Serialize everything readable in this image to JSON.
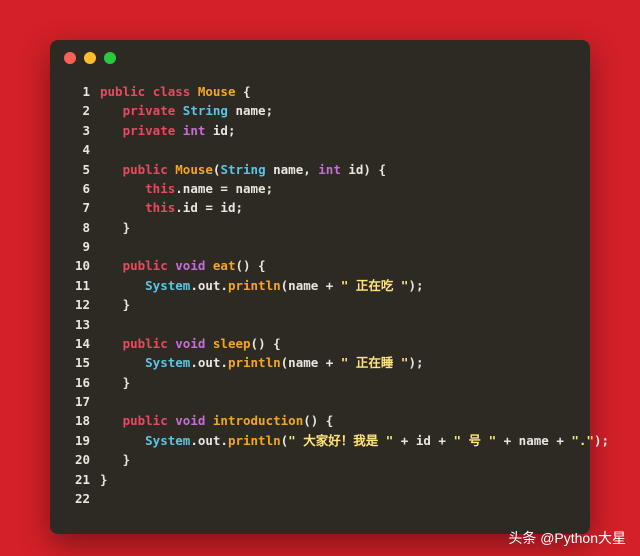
{
  "footer": "头条 @Python大星",
  "code": {
    "lines": [
      {
        "n": 1,
        "tokens": [
          [
            "",
            "kw",
            "public "
          ],
          [
            "",
            "kw",
            "class "
          ],
          [
            "",
            "cls",
            "Mouse"
          ],
          [
            "",
            " {"
          ]
        ]
      },
      {
        "n": 2,
        "tokens": [
          [
            "",
            "",
            "   "
          ],
          [
            "",
            "kw",
            "private "
          ],
          [
            "",
            "type",
            "String"
          ],
          [
            "",
            " name;"
          ]
        ]
      },
      {
        "n": 3,
        "tokens": [
          [
            "",
            "",
            "   "
          ],
          [
            "",
            "kw",
            "private "
          ],
          [
            "",
            "kw2",
            "int"
          ],
          [
            "",
            " id;"
          ]
        ]
      },
      {
        "n": 4,
        "tokens": []
      },
      {
        "n": 5,
        "tokens": [
          [
            "",
            "",
            "   "
          ],
          [
            "",
            "kw",
            "public "
          ],
          [
            "",
            "cls",
            "Mouse"
          ],
          [
            "",
            "",
            "("
          ],
          [
            "",
            "type",
            "String"
          ],
          [
            "",
            " name, "
          ],
          [
            "",
            "kw2",
            "int"
          ],
          [
            "",
            " id) {"
          ]
        ]
      },
      {
        "n": 6,
        "tokens": [
          [
            "",
            "",
            "      "
          ],
          [
            "",
            "kw",
            "this"
          ],
          [
            "",
            "",
            ".name = name;"
          ]
        ]
      },
      {
        "n": 7,
        "tokens": [
          [
            "",
            "",
            "      "
          ],
          [
            "",
            "kw",
            "this"
          ],
          [
            "",
            "",
            ".id = id;"
          ]
        ]
      },
      {
        "n": 8,
        "tokens": [
          [
            "",
            "",
            "   }"
          ]
        ]
      },
      {
        "n": 9,
        "tokens": []
      },
      {
        "n": 10,
        "tokens": [
          [
            "",
            "",
            "   "
          ],
          [
            "",
            "kw",
            "public "
          ],
          [
            "",
            "kw2",
            "void"
          ],
          [
            "",
            " "
          ],
          [
            "",
            "cls",
            "eat"
          ],
          [
            "",
            "",
            "() {"
          ]
        ]
      },
      {
        "n": 11,
        "tokens": [
          [
            "",
            "",
            "      "
          ],
          [
            "",
            "type",
            "System"
          ],
          [
            "",
            "",
            ".out."
          ],
          [
            "",
            "cls",
            "println"
          ],
          [
            "",
            "",
            "(name + "
          ],
          [
            "",
            "str",
            "\" 正在吃 \""
          ],
          [
            "",
            "",
            ");"
          ]
        ]
      },
      {
        "n": 12,
        "tokens": [
          [
            "",
            "",
            "   }"
          ]
        ]
      },
      {
        "n": 13,
        "tokens": []
      },
      {
        "n": 14,
        "tokens": [
          [
            "",
            "",
            "   "
          ],
          [
            "",
            "kw",
            "public "
          ],
          [
            "",
            "kw2",
            "void"
          ],
          [
            "",
            " "
          ],
          [
            "",
            "cls",
            "sleep"
          ],
          [
            "",
            "",
            "() {"
          ]
        ]
      },
      {
        "n": 15,
        "tokens": [
          [
            "",
            "",
            "      "
          ],
          [
            "",
            "type",
            "System"
          ],
          [
            "",
            "",
            ".out."
          ],
          [
            "",
            "cls",
            "println"
          ],
          [
            "",
            "",
            "(name + "
          ],
          [
            "",
            "str",
            "\" 正在睡 \""
          ],
          [
            "",
            "",
            ");"
          ]
        ]
      },
      {
        "n": 16,
        "tokens": [
          [
            "",
            "",
            "   }"
          ]
        ]
      },
      {
        "n": 17,
        "tokens": []
      },
      {
        "n": 18,
        "tokens": [
          [
            "",
            "",
            "   "
          ],
          [
            "",
            "kw",
            "public "
          ],
          [
            "",
            "kw2",
            "void"
          ],
          [
            "",
            " "
          ],
          [
            "",
            "cls",
            "introduction"
          ],
          [
            "",
            "",
            "() {"
          ]
        ]
      },
      {
        "n": 19,
        "tokens": [
          [
            "",
            "",
            "      "
          ],
          [
            "",
            "type",
            "System"
          ],
          [
            "",
            "",
            ".out."
          ],
          [
            "",
            "cls",
            "println"
          ],
          [
            "",
            "",
            "("
          ],
          [
            "",
            "str",
            "\" 大家好！我是 \""
          ],
          [
            "",
            " + id + "
          ],
          [
            "",
            "str",
            "\" 号 \""
          ],
          [
            "",
            " + name + "
          ],
          [
            "",
            "str",
            "\".\""
          ],
          [
            "",
            "",
            ");"
          ]
        ]
      },
      {
        "n": 20,
        "tokens": [
          [
            "",
            "",
            "   }"
          ]
        ]
      },
      {
        "n": 21,
        "tokens": [
          [
            "",
            "",
            "}"
          ]
        ]
      },
      {
        "n": 22,
        "tokens": []
      }
    ]
  }
}
